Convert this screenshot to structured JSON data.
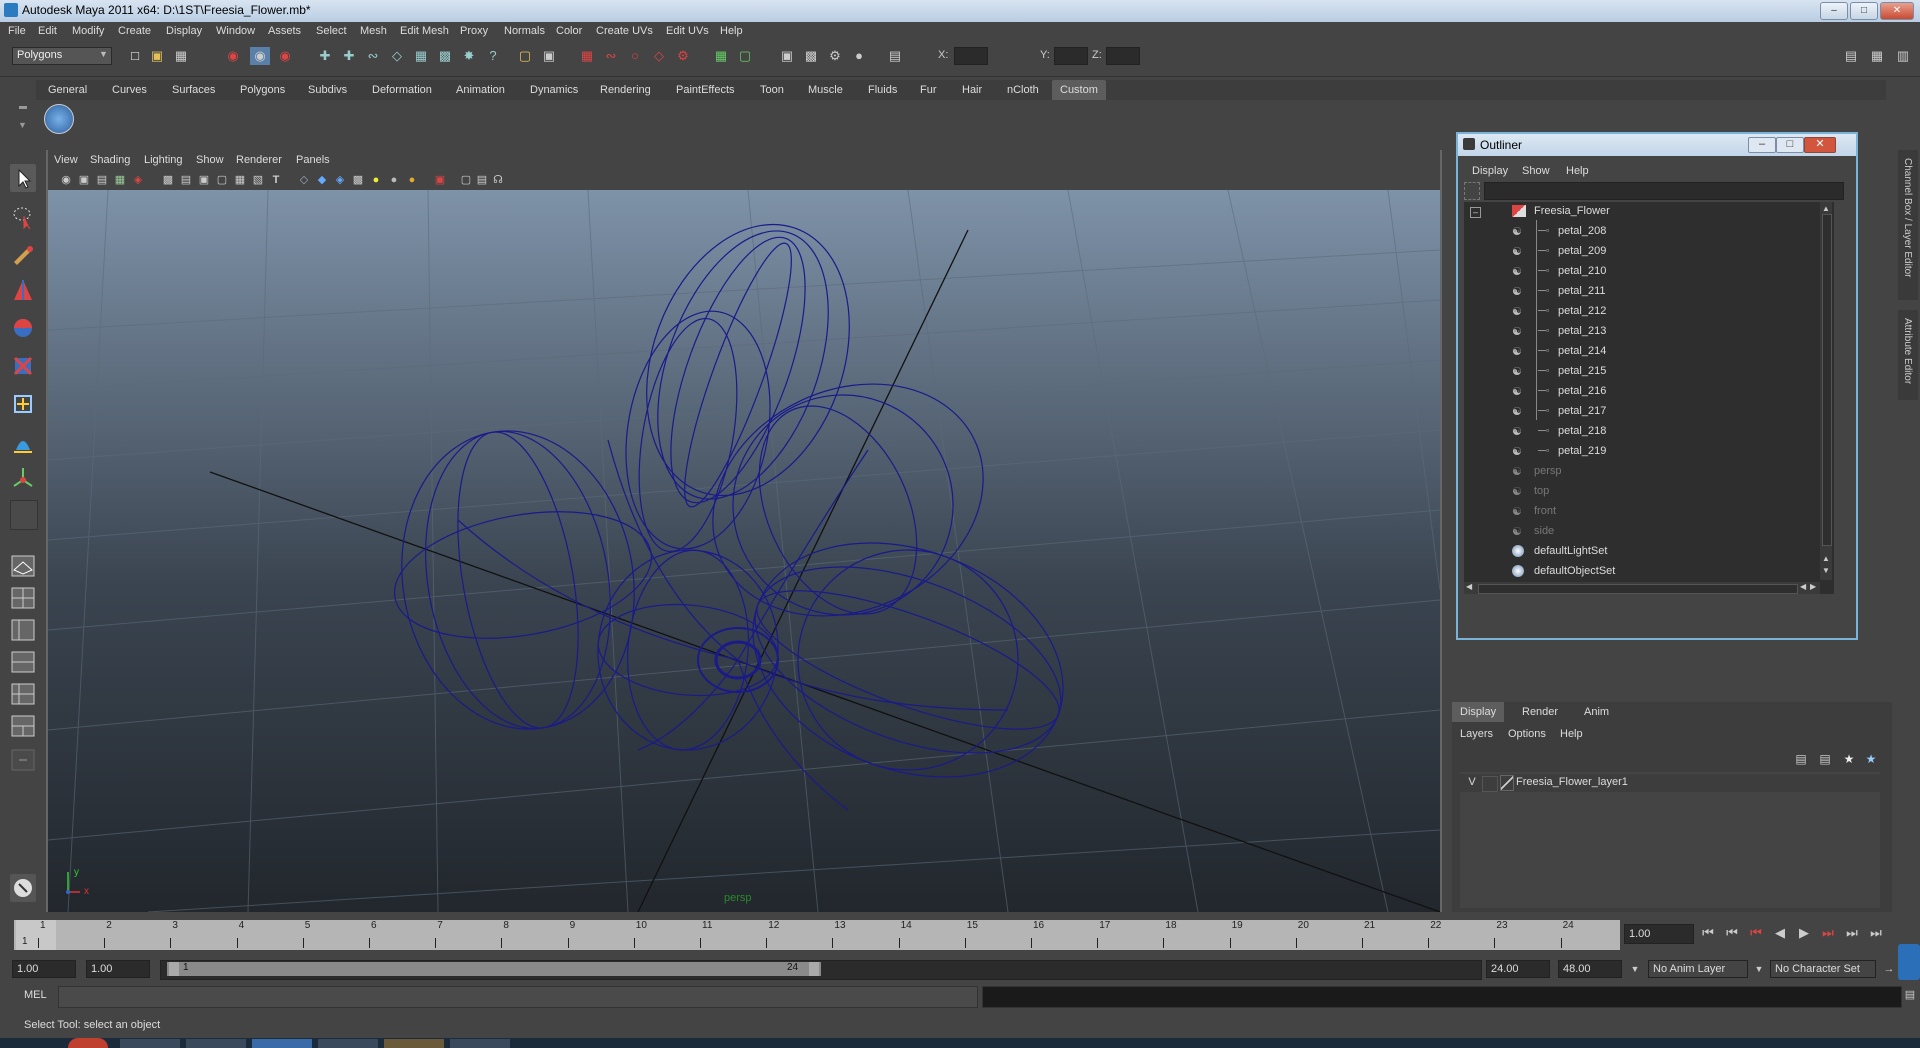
{
  "window": {
    "title": "Autodesk Maya 2011 x64: D:\\1ST\\Freesia_Flower.mb*"
  },
  "menus": [
    "File",
    "Edit",
    "Modify",
    "Create",
    "Display",
    "Window",
    "Assets",
    "Select",
    "Mesh",
    "Edit Mesh",
    "Proxy",
    "Normals",
    "Color",
    "Create UVs",
    "Edit UVs",
    "Help"
  ],
  "status_line": {
    "mode": "Polygons",
    "x_label": "X:",
    "y_label": "Y:",
    "z_label": "Z:"
  },
  "shelf_tabs": [
    "General",
    "Curves",
    "Surfaces",
    "Polygons",
    "Subdivs",
    "Deformation",
    "Animation",
    "Dynamics",
    "Rendering",
    "PaintEffects",
    "Toon",
    "Muscle",
    "Fluids",
    "Fur",
    "Hair",
    "nCloth",
    "Custom"
  ],
  "shelf_active": "Custom",
  "viewport": {
    "menus": [
      "View",
      "Shading",
      "Lighting",
      "Show",
      "Renderer",
      "Panels"
    ],
    "camera_label": "persp",
    "axis_x": "x",
    "axis_y": "y",
    "wireframe_color": "#1a1a8a"
  },
  "outliner": {
    "title": "Outliner",
    "menus": [
      "Display",
      "Show",
      "Help"
    ],
    "root": "Freesia_Flower",
    "children": [
      "petal_208",
      "petal_209",
      "petal_210",
      "petal_211",
      "petal_212",
      "petal_213",
      "petal_214",
      "petal_215",
      "petal_216",
      "petal_217",
      "petal_218",
      "petal_219"
    ],
    "cameras": [
      "persp",
      "top",
      "front",
      "side"
    ],
    "sets": [
      "defaultLightSet",
      "defaultObjectSet"
    ]
  },
  "side_tabs": {
    "channel_box": "Channel Box / Layer Editor",
    "attribute_editor": "Attribute Editor"
  },
  "layer_editor": {
    "tabs": [
      "Display",
      "Render",
      "Anim"
    ],
    "active_tab": "Display",
    "menus": [
      "Layers",
      "Options",
      "Help"
    ],
    "layer_visibility": "V",
    "layer_name": "Freesia_Flower_layer1"
  },
  "time_slider": {
    "ticks": [
      "1",
      "2",
      "3",
      "4",
      "5",
      "6",
      "7",
      "8",
      "9",
      "10",
      "11",
      "12",
      "13",
      "14",
      "15",
      "16",
      "17",
      "18",
      "19",
      "20",
      "21",
      "22",
      "23",
      "24"
    ],
    "current_frame_marker": "1",
    "current_time": "1.00"
  },
  "range_slider": {
    "start_time": "1.00",
    "playback_start": "1.00",
    "range_start_label": "1",
    "range_end_label": "24",
    "playback_end": "24.00",
    "end_time": "48.00",
    "anim_layer": "No Anim Layer",
    "character_set": "No Character Set"
  },
  "command_line": {
    "label": "MEL"
  },
  "help_line": {
    "text": "Select Tool: select an object"
  }
}
